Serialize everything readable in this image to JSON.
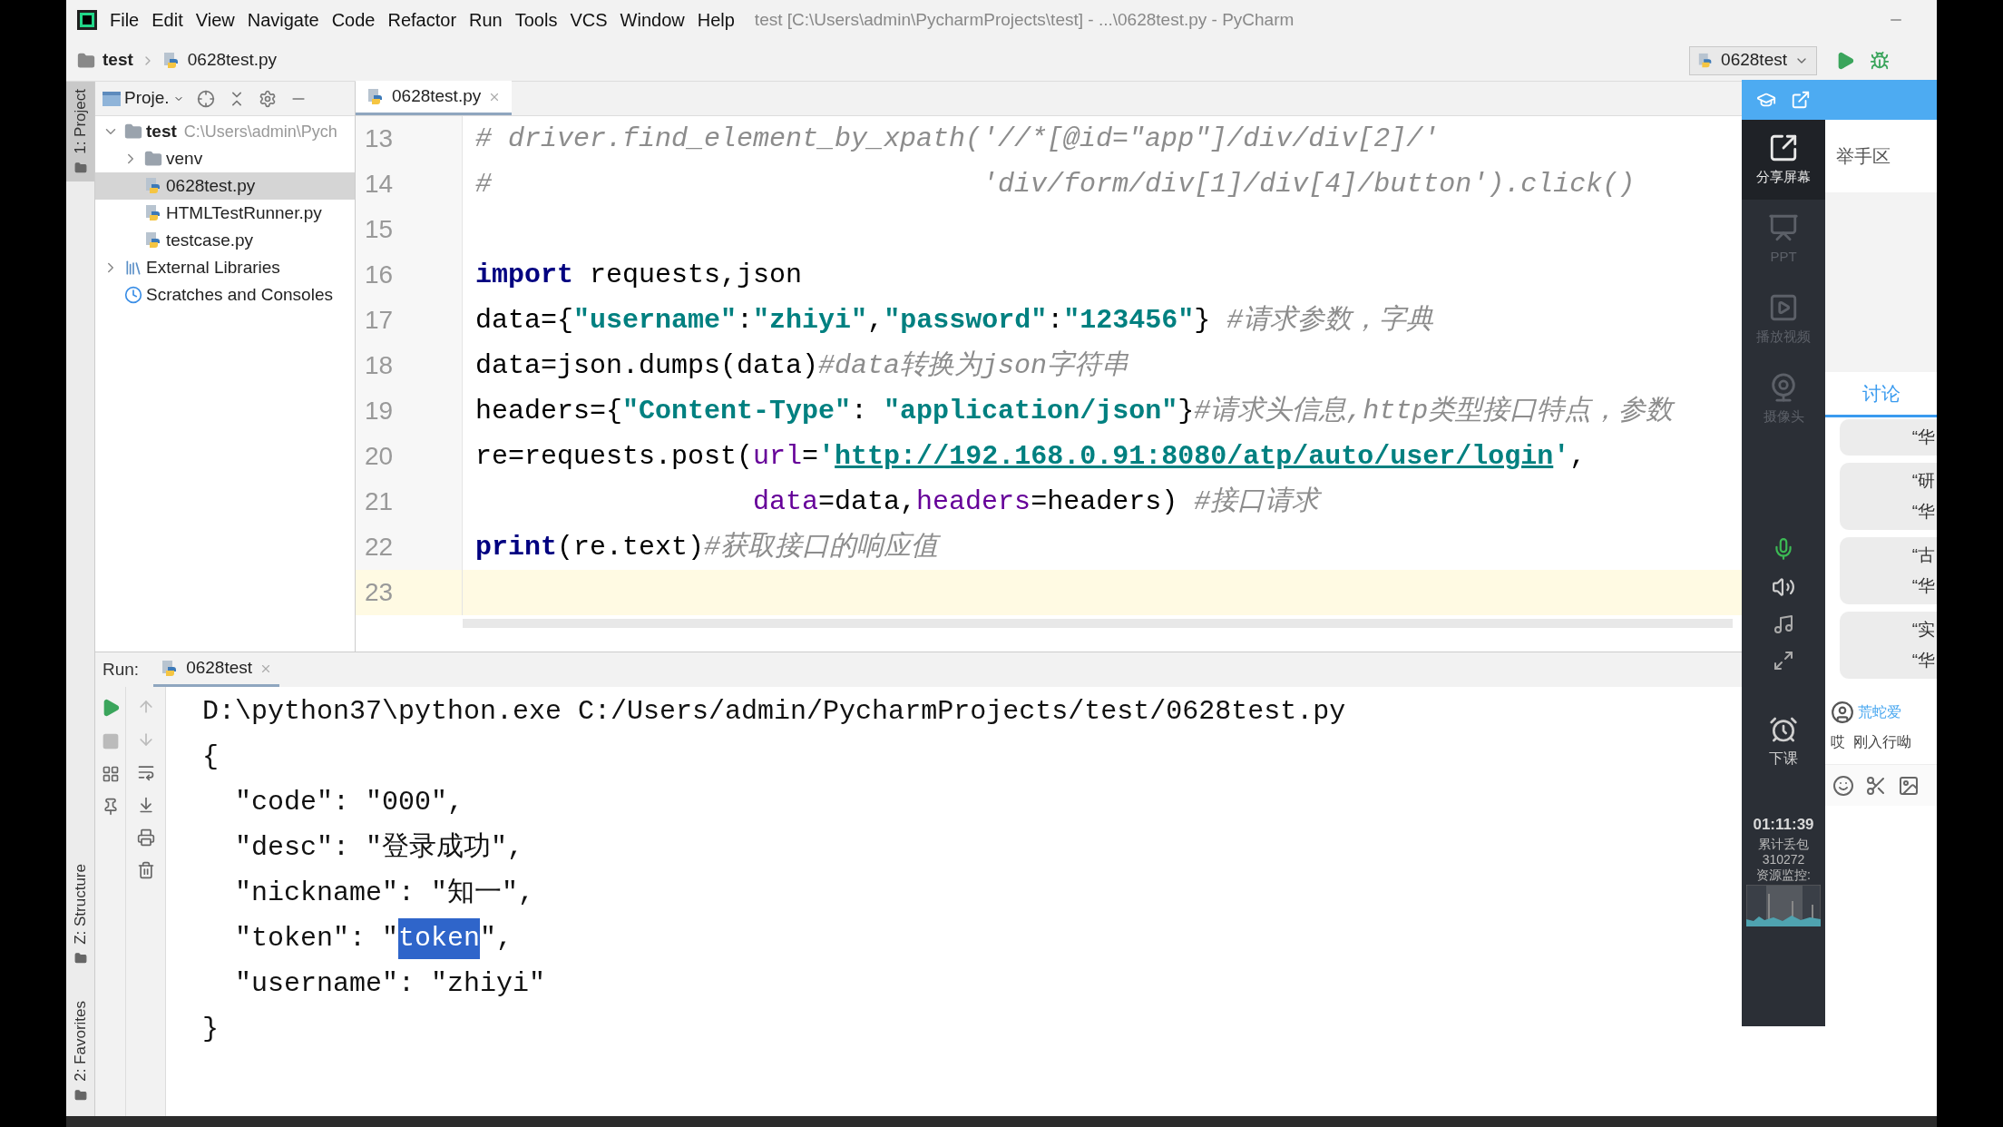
{
  "menu": [
    "File",
    "Edit",
    "View",
    "Navigate",
    "Code",
    "Refactor",
    "Run",
    "Tools",
    "VCS",
    "Window",
    "Help"
  ],
  "window": {
    "title": "test [C:\\Users\\admin\\PycharmProjects\\test] - ...\\0628test.py - PyCharm"
  },
  "breadcrumb": [
    "test",
    "0628test.py"
  ],
  "run_config": "0628test",
  "tool_strip": {
    "top": [
      {
        "label": "1: Project",
        "selected": true
      }
    ],
    "bottom": [
      {
        "label": "Z: Structure",
        "selected": false
      },
      {
        "label": "2: Favorites",
        "selected": false
      }
    ]
  },
  "project": {
    "title": "Proje.",
    "tree": [
      {
        "label": "test",
        "path": "C:\\Users\\admin\\Pych",
        "kind": "folder",
        "expanded": true,
        "selected": false,
        "children": [
          {
            "label": "venv",
            "kind": "folder",
            "expanded": false,
            "selected": false
          },
          {
            "label": "0628test.py",
            "kind": "python",
            "selected": true
          },
          {
            "label": "HTMLTestRunner.py",
            "kind": "python",
            "selected": false
          },
          {
            "label": "testcase.py",
            "kind": "python",
            "selected": false
          }
        ]
      },
      {
        "label": "External Libraries",
        "kind": "library",
        "expanded": false,
        "selected": false
      },
      {
        "label": "Scratches and Consoles",
        "kind": "scratches",
        "selected": false
      }
    ]
  },
  "editor": {
    "tab": "0628test.py",
    "lines": [
      {
        "number": "13",
        "current": false,
        "tokens": [
          {
            "kind": "comment",
            "text": "# driver.find_element_by_xpath('//*[@id=\"app\"]/div/div[2]/'"
          }
        ]
      },
      {
        "number": "14",
        "current": false,
        "tokens": [
          {
            "kind": "comment",
            "text": "#                              'div/form/div[1]/div[4]/button').click()"
          }
        ]
      },
      {
        "number": "15",
        "current": false
      },
      {
        "number": "16",
        "current": false,
        "tokens": [
          {
            "kind": "keyword",
            "text": "import"
          },
          {
            "kind": "plain",
            "text": " requests,json"
          }
        ]
      },
      {
        "number": "17",
        "current": false,
        "tokens": [
          {
            "kind": "plain",
            "text": "data={"
          },
          {
            "kind": "string",
            "text": "\"username\""
          },
          {
            "kind": "plain",
            "text": ":"
          },
          {
            "kind": "string",
            "text": "\"zhiyi\""
          },
          {
            "kind": "plain",
            "text": ","
          },
          {
            "kind": "string",
            "text": "\"password\""
          },
          {
            "kind": "plain",
            "text": ":"
          },
          {
            "kind": "string",
            "text": "\"123456\""
          },
          {
            "kind": "plain",
            "text": "} "
          },
          {
            "kind": "comment",
            "text": "#请求参数，字典"
          }
        ]
      },
      {
        "number": "18",
        "current": false,
        "tokens": [
          {
            "kind": "plain",
            "text": "data=json.dumps(data)"
          },
          {
            "kind": "comment",
            "text": "#data转换为json字符串"
          }
        ]
      },
      {
        "number": "19",
        "current": false,
        "tokens": [
          {
            "kind": "plain",
            "text": "headers={"
          },
          {
            "kind": "string",
            "text": "\"Content-Type\""
          },
          {
            "kind": "plain",
            "text": ": "
          },
          {
            "kind": "string",
            "text": "\"application/json\""
          },
          {
            "kind": "plain",
            "text": "}"
          },
          {
            "kind": "comment",
            "text": "#请求头信息,http类型接口特点，参数"
          }
        ]
      },
      {
        "number": "20",
        "current": false,
        "tokens": [
          {
            "kind": "plain",
            "text": "re=requests.post("
          },
          {
            "kind": "param",
            "text": "url"
          },
          {
            "kind": "plain",
            "text": "="
          },
          {
            "kind": "string",
            "text": "'"
          },
          {
            "kind": "link",
            "text": "http://192.168.0.91:8080/atp/auto/user/login"
          },
          {
            "kind": "string",
            "text": "'"
          },
          {
            "kind": "plain",
            "text": ","
          }
        ]
      },
      {
        "number": "21",
        "current": false,
        "tokens": [
          {
            "kind": "param",
            "text": "                 data"
          },
          {
            "kind": "plain",
            "text": "=data,"
          },
          {
            "kind": "param",
            "text": "headers"
          },
          {
            "kind": "plain",
            "text": "=headers) "
          },
          {
            "kind": "comment",
            "text": "#接口请求"
          }
        ]
      },
      {
        "number": "22",
        "current": false,
        "tokens": [
          {
            "kind": "keyword",
            "text": "print"
          },
          {
            "kind": "plain",
            "text": "(re.text)"
          },
          {
            "kind": "comment",
            "text": "#获取接口的响应值"
          }
        ]
      },
      {
        "number": "23",
        "current": true
      }
    ]
  },
  "run": {
    "label": "Run:",
    "tab": "0628test",
    "output": [
      [
        {
          "text": "D:\\python37\\python.exe C:/Users/admin/PycharmProjects/test/0628test.py",
          "selected": false
        }
      ],
      [
        {
          "text": "{",
          "selected": false
        }
      ],
      [
        {
          "text": "  \"code\": \"000\",",
          "selected": false
        }
      ],
      [
        {
          "text": "  \"desc\": \"登录成功\",",
          "selected": false
        }
      ],
      [
        {
          "text": "  \"nickname\": \"知一\",",
          "selected": false
        }
      ],
      [
        {
          "text": "  \"token\": \"",
          "selected": false
        },
        {
          "text": "token",
          "selected": true
        },
        {
          "text": "\",",
          "selected": false
        }
      ],
      [
        {
          "text": "  \"username\": \"zhiyi\"",
          "selected": false
        }
      ],
      [
        {
          "text": "}",
          "selected": false
        }
      ]
    ]
  },
  "meeting": {
    "tools": [
      {
        "label": "分享屏幕",
        "kind": "share",
        "active": true
      },
      {
        "label": "PPT",
        "kind": "ppt",
        "active": false
      },
      {
        "label": "播放视频",
        "kind": "video",
        "active": false
      },
      {
        "label": "摄像头",
        "kind": "camera",
        "active": false
      }
    ],
    "end_class": "下课",
    "timer": "01:11:39",
    "stats": [
      "累计丢包",
      "310272",
      "资源监控:"
    ],
    "hand_raise_title": "举手区",
    "tabs": [
      {
        "label": "讨论",
        "selected": true
      }
    ],
    "messages": [
      [
        "“华"
      ],
      [
        "“研",
        "“华"
      ],
      [
        "“古",
        "“华"
      ],
      [
        "“实",
        "“华"
      ]
    ],
    "user": "荒蛇爱",
    "user_message": "哎  刚入行呦"
  }
}
